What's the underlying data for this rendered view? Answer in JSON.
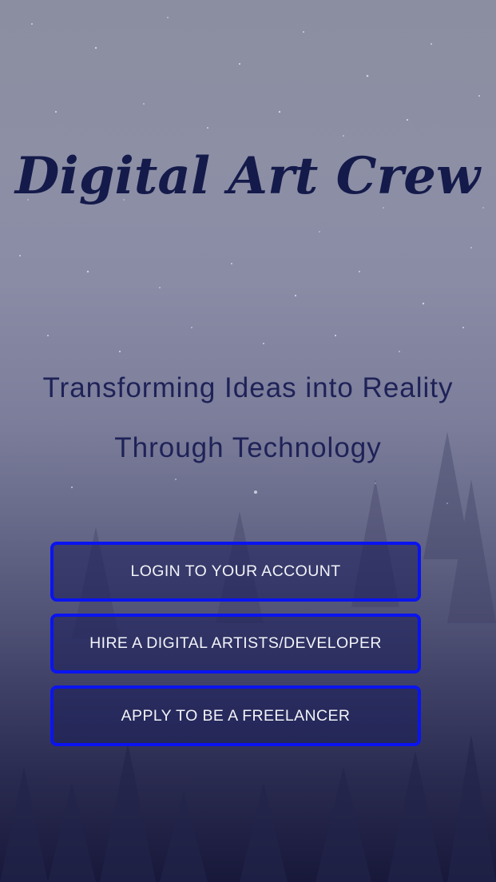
{
  "app": {
    "logo_text": "Digital Art Crew",
    "tagline_line1": "Transforming Ideas into Reality",
    "tagline_line2": "Through Technology"
  },
  "actions": {
    "login_label": "LOGIN TO YOUR ACCOUNT",
    "hire_label": "HIRE A DIGITAL ARTISTS/DEVELOPER",
    "apply_label": "APPLY TO BE A FREELANCER"
  },
  "colors": {
    "logo": "#141a4a",
    "tagline": "#1f2257",
    "button_border": "#0a14f0",
    "button_text": "#f3f3f8",
    "sky_top": "#8b8da0",
    "sky_bottom": "#17183a"
  },
  "icons": {
    "background": "starry-forest-background"
  }
}
